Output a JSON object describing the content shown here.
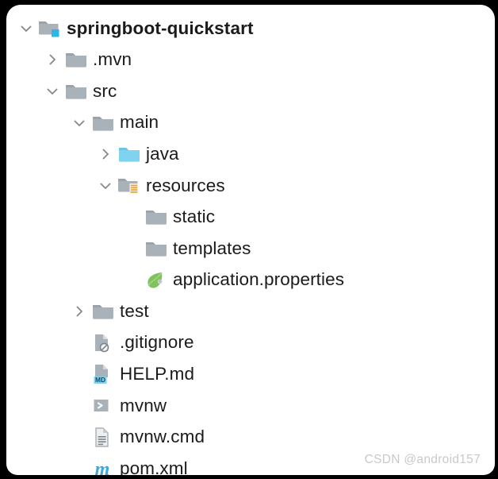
{
  "panel": {
    "background": "#ffffff",
    "outer_background": "#000000",
    "text_color": "#1b1b1b"
  },
  "colors": {
    "folder_grey": "#a9b1b9",
    "folder_grey_dark": "#9aa3ab",
    "source_blue": "#7fd3ef",
    "badge_blue": "#29b6e8",
    "resources_orange": "#e8a33d",
    "spring_green": "#7ec45a",
    "gear_grey": "#b0b6bb",
    "md_badge": "#7fd3ef",
    "maven_blue": "#3ba9dc",
    "chevron_grey": "#8a8a8a",
    "watermark_grey": "#c9c9c9"
  },
  "tree": {
    "title": "springboot-quickstart",
    "nodes": [
      {
        "name": "springboot-quickstart",
        "depth": 0,
        "twisty": "chevron-down",
        "icon": "module-folder-icon",
        "bold": true
      },
      {
        "name": ".mvn",
        "depth": 1,
        "twisty": "chevron-right",
        "icon": "folder-icon",
        "bold": false
      },
      {
        "name": "src",
        "depth": 1,
        "twisty": "chevron-down",
        "icon": "folder-icon",
        "bold": false
      },
      {
        "name": "main",
        "depth": 2,
        "twisty": "chevron-down",
        "icon": "folder-icon",
        "bold": false
      },
      {
        "name": "java",
        "depth": 3,
        "twisty": "chevron-right",
        "icon": "source-root-folder-icon",
        "bold": false
      },
      {
        "name": "resources",
        "depth": 3,
        "twisty": "chevron-down",
        "icon": "resources-folder-icon",
        "bold": false
      },
      {
        "name": "static",
        "depth": 4,
        "twisty": "none",
        "icon": "folder-icon",
        "bold": false
      },
      {
        "name": "templates",
        "depth": 4,
        "twisty": "none",
        "icon": "folder-icon",
        "bold": false
      },
      {
        "name": "application.properties",
        "depth": 4,
        "twisty": "none",
        "icon": "spring-properties-icon",
        "bold": false
      },
      {
        "name": "test",
        "depth": 2,
        "twisty": "chevron-right",
        "icon": "folder-icon",
        "bold": false
      },
      {
        "name": ".gitignore",
        "depth": 2,
        "twisty": "none",
        "icon": "gitignore-file-icon",
        "bold": false
      },
      {
        "name": "HELP.md",
        "depth": 2,
        "twisty": "none",
        "icon": "markdown-file-icon",
        "bold": false
      },
      {
        "name": "mvnw",
        "depth": 2,
        "twisty": "none",
        "icon": "shell-script-icon",
        "bold": false
      },
      {
        "name": "mvnw.cmd",
        "depth": 2,
        "twisty": "none",
        "icon": "text-file-icon",
        "bold": false
      },
      {
        "name": "pom.xml",
        "depth": 2,
        "twisty": "none",
        "icon": "maven-pom-icon",
        "bold": false
      }
    ]
  },
  "markdown_badge_text": "MD",
  "maven_glyph": "m",
  "watermark": "CSDN @android157"
}
